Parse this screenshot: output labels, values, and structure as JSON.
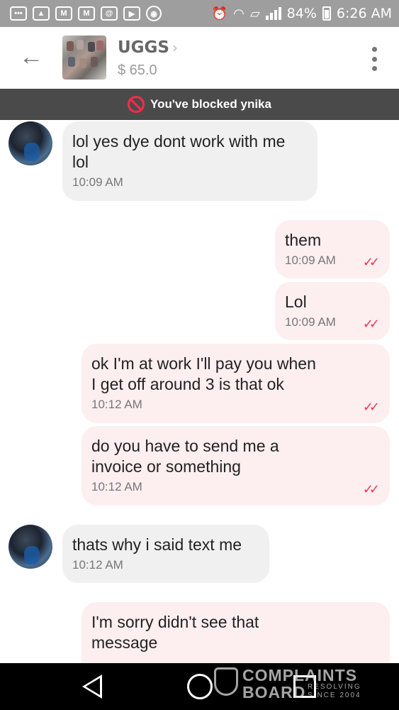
{
  "status_bar": {
    "battery": "84%",
    "time": "6:26 AM"
  },
  "header": {
    "title": "UGGS",
    "price": "$ 65.0"
  },
  "banner": {
    "text": "You've blocked ynika"
  },
  "messages": [
    {
      "direction": "in",
      "text": "lol yes dye dont work with me\nlol",
      "time": "10:09 AM"
    },
    {
      "direction": "out",
      "text": "them",
      "time": "10:09 AM"
    },
    {
      "direction": "out",
      "text": "Lol",
      "time": "10:09 AM"
    },
    {
      "direction": "out",
      "text": "ok I'm at work I'll pay you when\nI get off around 3 is that ok",
      "time": "10:12 AM"
    },
    {
      "direction": "out",
      "text": "do you have to send me a\ninvoice or something",
      "time": "10:12 AM"
    },
    {
      "direction": "in",
      "text": "thats why i said text me",
      "time": "10:12 AM"
    },
    {
      "direction": "out",
      "text": "I'm sorry didn't see that\nmessage",
      "time": ""
    }
  ],
  "watermark": {
    "line1": "COMPLAINTS",
    "line2": "BOARD",
    "tagline": "RESOLVING\nSINCE 2004"
  },
  "colors": {
    "status_bar": "#9e9e9e",
    "banner": "#4a4a4a",
    "incoming_bubble": "#f0f0f0",
    "outgoing_bubble": "#fdeef0",
    "read_ticks": "#e8384f",
    "block_icon": "#ff2a4a"
  }
}
